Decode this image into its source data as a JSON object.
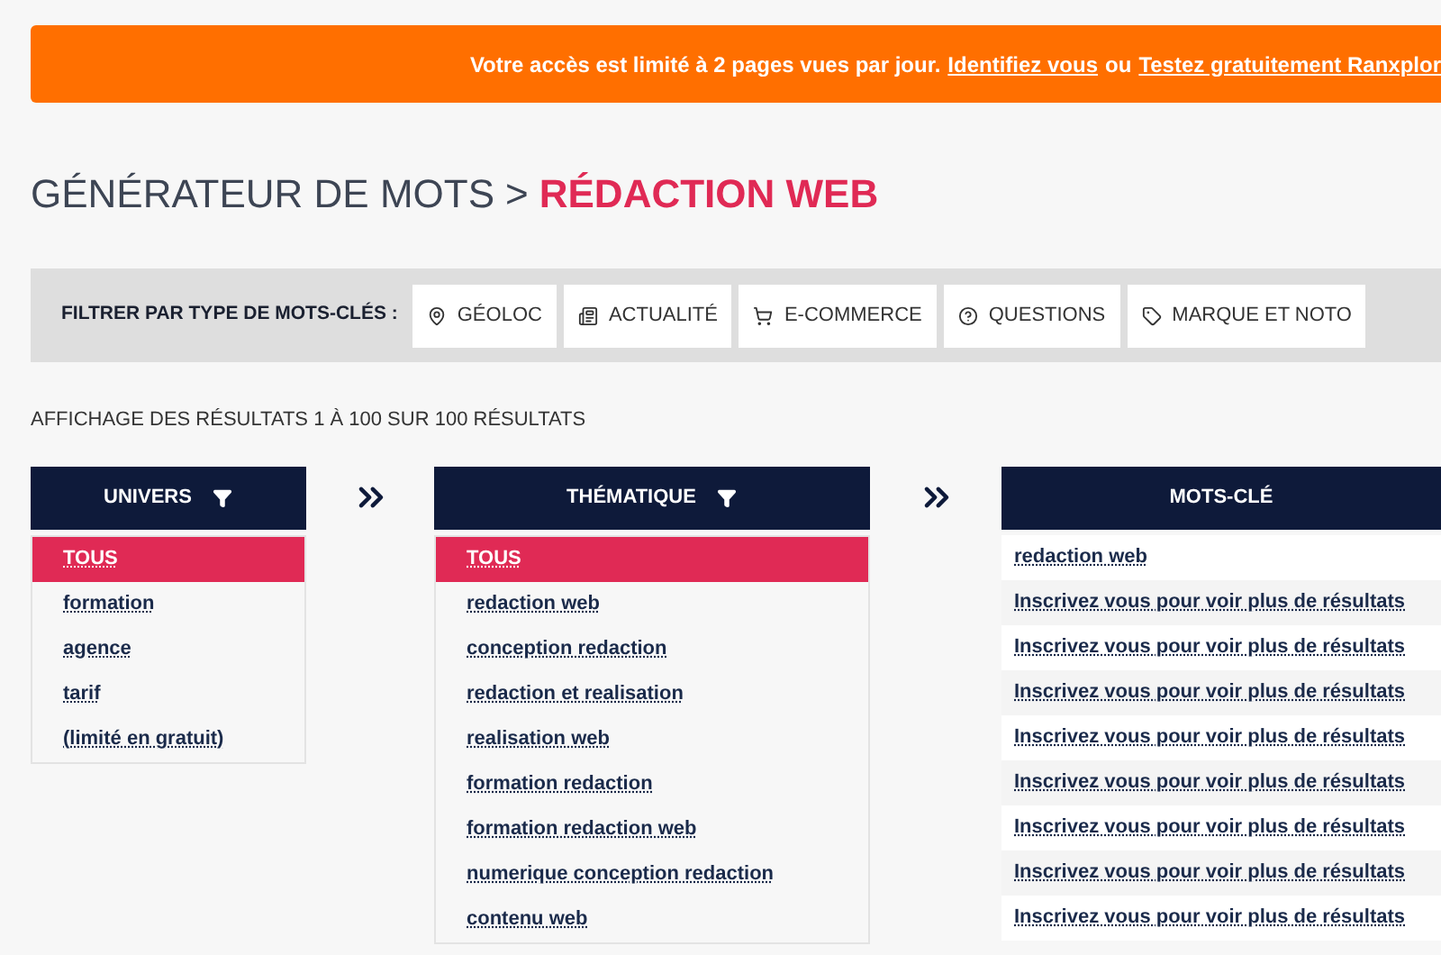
{
  "banner": {
    "message": "Votre accès est limité à 2 pages vues par jour.",
    "login_link": "Identifiez vous",
    "separator": "ou",
    "trial_link": "Testez gratuitement Ranxplor"
  },
  "breadcrumb": {
    "parent": "GÉNÉRATEUR DE MOTS",
    "separator": ">",
    "current": "RÉDACTION WEB"
  },
  "filter_bar": {
    "label": "FILTRER PAR TYPE DE MOTS-CLÉS :",
    "chips": [
      {
        "kind": "pin",
        "label": "GÉOLOC"
      },
      {
        "kind": "news",
        "label": "ACTUALITÉ"
      },
      {
        "kind": "cart",
        "label": "E-COMMERCE"
      },
      {
        "kind": "question",
        "label": "QUESTIONS"
      },
      {
        "kind": "tag",
        "label": "MARQUE ET NOTO"
      }
    ]
  },
  "results_summary": "AFFICHAGE DES RÉSULTATS 1 À 100 SUR 100 RÉSULTATS",
  "univers": {
    "title": "UNIVERS",
    "items": [
      {
        "label": "TOUS",
        "selected": true
      },
      {
        "label": "formation",
        "selected": false
      },
      {
        "label": "agence",
        "selected": false
      },
      {
        "label": "tarif",
        "selected": false
      },
      {
        "label": "(limité en gratuit)",
        "selected": false
      }
    ]
  },
  "thematique": {
    "title": "THÉMATIQUE",
    "items": [
      {
        "label": "TOUS",
        "selected": true
      },
      {
        "label": "redaction web",
        "selected": false
      },
      {
        "label": "conception redaction",
        "selected": false
      },
      {
        "label": "redaction et realisation",
        "selected": false
      },
      {
        "label": "realisation web",
        "selected": false
      },
      {
        "label": "formation redaction",
        "selected": false
      },
      {
        "label": "formation redaction web",
        "selected": false
      },
      {
        "label": "numerique conception redaction",
        "selected": false
      },
      {
        "label": "contenu web",
        "selected": false
      }
    ]
  },
  "keywords": {
    "title": "MOTS-CLÉ",
    "rows": [
      "redaction web",
      "Inscrivez vous pour voir plus de résultats",
      "Inscrivez vous pour voir plus de résultats",
      "Inscrivez vous pour voir plus de résultats",
      "Inscrivez vous pour voir plus de résultats",
      "Inscrivez vous pour voir plus de résultats",
      "Inscrivez vous pour voir plus de résultats",
      "Inscrivez vous pour voir plus de résultats",
      "Inscrivez vous pour voir plus de résultats"
    ]
  }
}
